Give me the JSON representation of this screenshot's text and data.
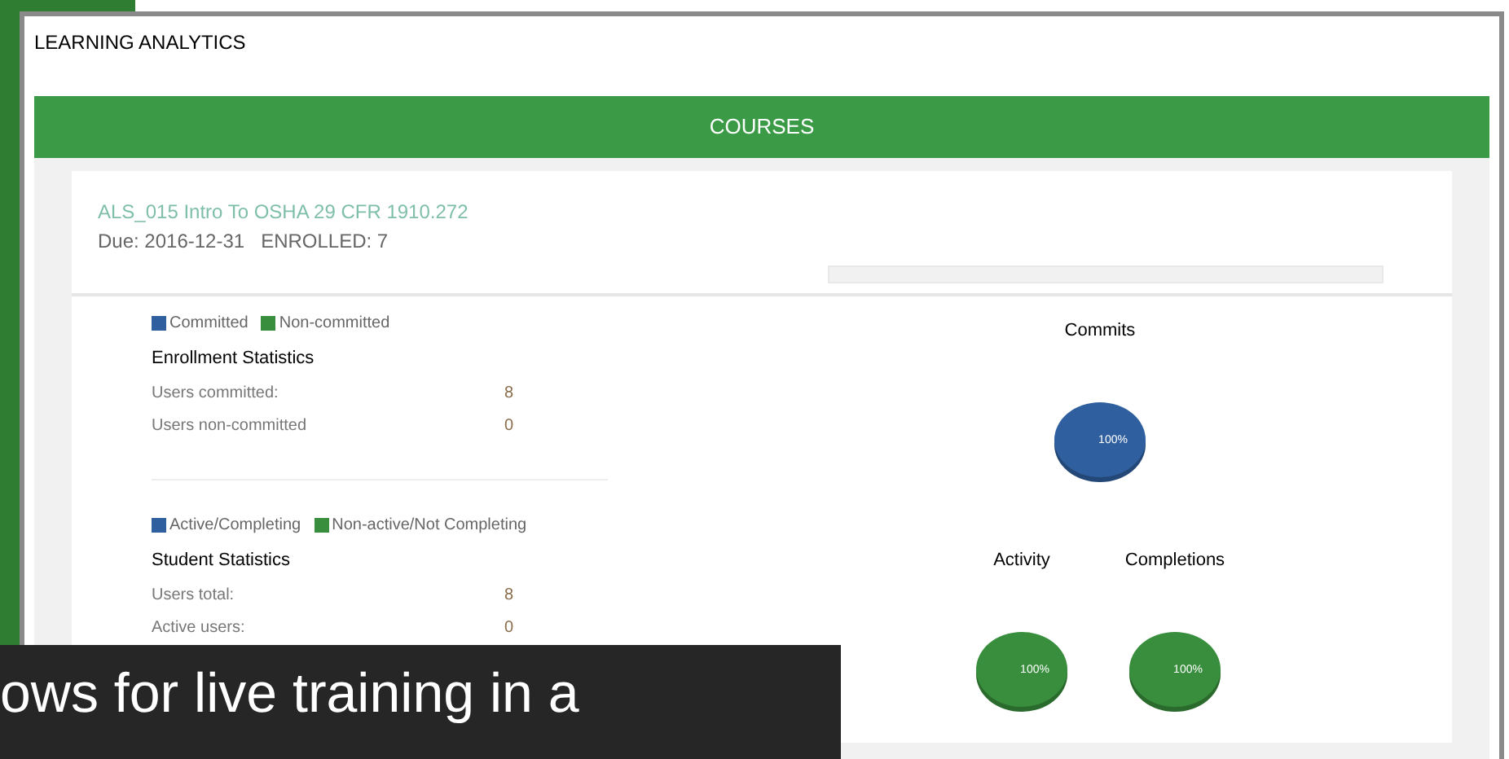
{
  "window": {
    "title": "LEARNING ANALYTICS"
  },
  "header": {
    "title": "COURSES"
  },
  "course": {
    "title": "ALS_015 Intro To OSHA 29 CFR 1910.272",
    "due": "Due: 2016-12-31",
    "enrolled": "ENROLLED: 7"
  },
  "sections": [
    {
      "legend": [
        {
          "label": "Committed",
          "color": "#2f5f9e"
        },
        {
          "label": "Non-committed",
          "color": "#388e3c"
        }
      ],
      "title": "Enrollment Statistics",
      "rows": [
        {
          "label": "Users committed:",
          "value": "8"
        },
        {
          "label": "Users non-committed",
          "value": "0"
        }
      ]
    },
    {
      "legend": [
        {
          "label": "Active/Completing",
          "color": "#2f5f9e"
        },
        {
          "label": "Non-active/Not Completing",
          "color": "#388e3c"
        }
      ],
      "title": "Student Statistics",
      "rows": [
        {
          "label": "Users total:",
          "value": "8"
        },
        {
          "label": "Active users:",
          "value": "0"
        }
      ]
    }
  ],
  "charts": [
    {
      "title": "Commits",
      "label": "100%",
      "color": "#2f5f9e"
    },
    {
      "title": "Activity",
      "label": "100%",
      "color": "#388e3c"
    },
    {
      "title": "Completions",
      "label": "100%",
      "color": "#388e3c"
    }
  ],
  "caption": {
    "text": "ows for live training in a"
  }
}
